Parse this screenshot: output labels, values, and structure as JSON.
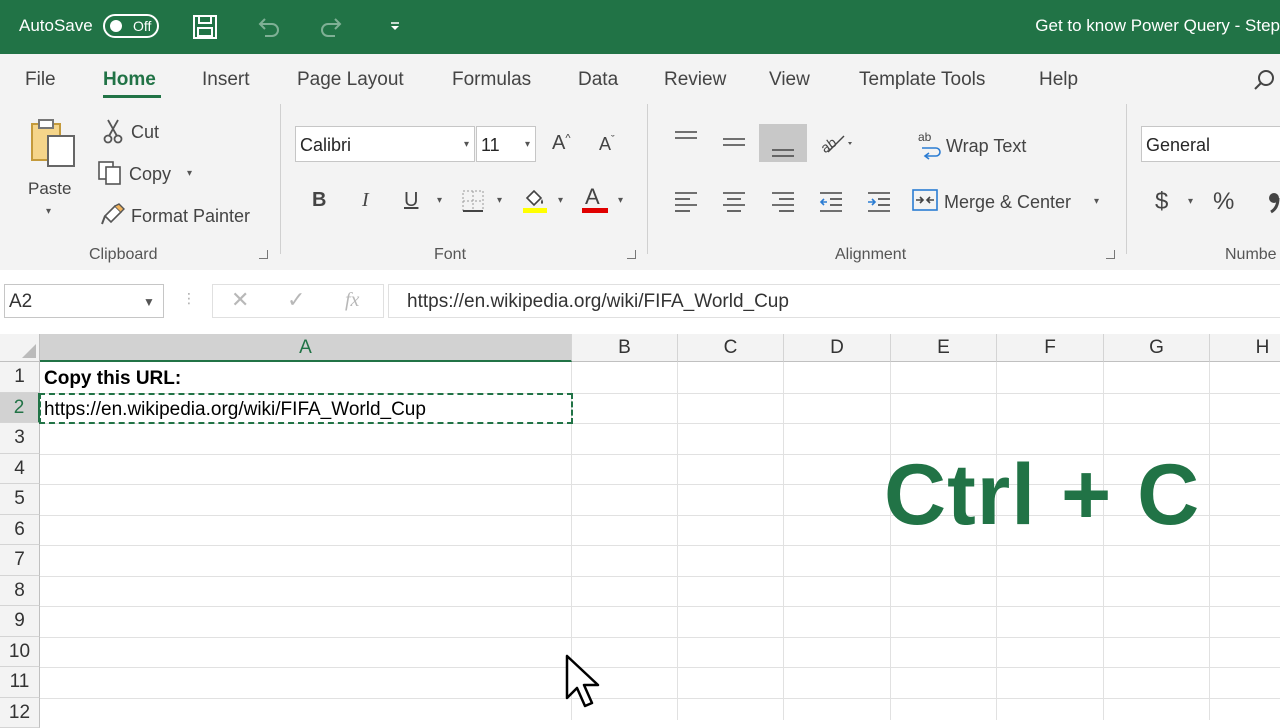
{
  "titlebar": {
    "autosave_label": "AutoSave",
    "autosave_state": "Off",
    "document_title": "Get to know Power Query - Step"
  },
  "tabs": [
    "File",
    "Home",
    "Insert",
    "Page Layout",
    "Formulas",
    "Data",
    "Review",
    "View",
    "Template Tools",
    "Help"
  ],
  "active_tab": "Home",
  "ribbon": {
    "clipboard": {
      "paste": "Paste",
      "cut": "Cut",
      "copy": "Copy",
      "format_painter": "Format Painter",
      "group_label": "Clipboard"
    },
    "font": {
      "font_name": "Calibri",
      "font_size": "11",
      "bold": "B",
      "italic": "I",
      "underline": "U",
      "font_color_letter": "A",
      "grow_letter": "A",
      "shrink_letter": "A",
      "group_label": "Font"
    },
    "alignment": {
      "wrap_text": "Wrap Text",
      "merge_center": "Merge & Center",
      "group_label": "Alignment"
    },
    "number": {
      "format": "General",
      "currency": "$",
      "percent": "%",
      "group_label": "Numbe"
    }
  },
  "formula_bar": {
    "name_box": "A2",
    "fx": "fx",
    "value": "https://en.wikipedia.org/wiki/FIFA_World_Cup"
  },
  "grid": {
    "columns": [
      "A",
      "B",
      "C",
      "D",
      "E",
      "F",
      "G",
      "H"
    ],
    "rows": [
      "1",
      "2",
      "3",
      "4",
      "5",
      "6",
      "7",
      "8",
      "9",
      "10",
      "11",
      "12"
    ],
    "selected_cell": "A2",
    "cells": {
      "A1": "Copy this URL:",
      "A2": "https://en.wikipedia.org/wiki/FIFA_World_Cup"
    }
  },
  "overlay_text": "Ctrl + C",
  "colors": {
    "accent": "#217346",
    "highlight_yellow": "#ffff00",
    "font_red": "#e00000"
  }
}
